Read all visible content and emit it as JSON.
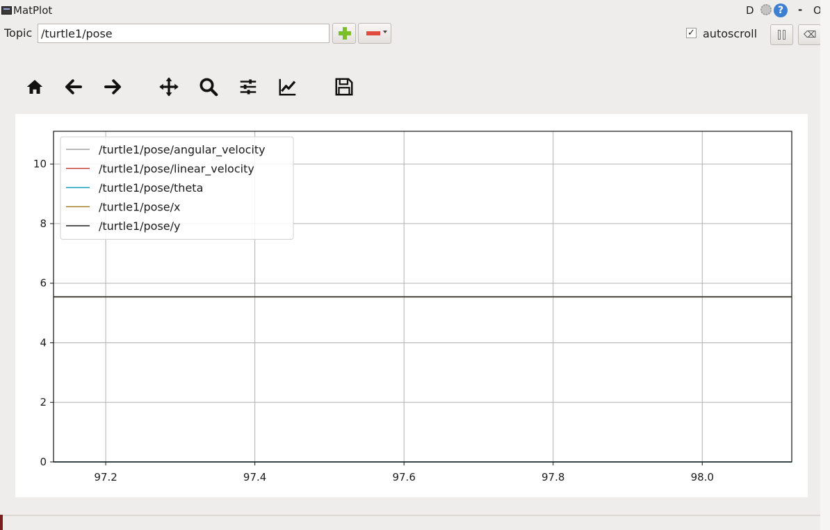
{
  "window": {
    "title": "MatPlot",
    "d_label": "D",
    "help_label": "?",
    "minimize_label": "-",
    "close_label": "O"
  },
  "topic": {
    "label": "Topic",
    "value": "/turtle1/pose"
  },
  "autoscroll": {
    "label": "autoscroll",
    "checked": true
  },
  "icons": {
    "home": "home-icon",
    "back": "back-arrow-icon",
    "forward": "forward-arrow-icon",
    "pan": "pan-icon",
    "zoom": "zoom-icon",
    "configure": "configure-subplots-icon",
    "edit": "edit-axis-icon",
    "save": "save-icon",
    "add": "plus-icon",
    "remove": "minus-icon",
    "pause": "pause-icon",
    "clear": "clear-icon"
  },
  "chart_data": {
    "type": "line",
    "xlim": [
      97.13,
      98.12
    ],
    "ylim": [
      0,
      11.1
    ],
    "xticks": [
      97.2,
      97.4,
      97.6,
      97.8,
      98.0
    ],
    "xtick_labels": [
      "97.2",
      "97.4",
      "97.6",
      "97.8",
      "98.0"
    ],
    "yticks": [
      0,
      2,
      4,
      6,
      8,
      10
    ],
    "ytick_labels": [
      "0",
      "2",
      "4",
      "6",
      "8",
      "10"
    ],
    "grid": true,
    "legend_position": "top-left",
    "series": [
      {
        "name": "/turtle1/pose/angular_velocity",
        "color": "#a0a0a0",
        "x": [
          97.13,
          98.12
        ],
        "y": [
          0,
          0
        ]
      },
      {
        "name": "/turtle1/pose/linear_velocity",
        "color": "#c0392b",
        "x": [
          97.13,
          98.12
        ],
        "y": [
          0,
          0
        ]
      },
      {
        "name": "/turtle1/pose/theta",
        "color": "#17a2b8",
        "x": [
          97.13,
          98.12
        ],
        "y": [
          0,
          0
        ]
      },
      {
        "name": "/turtle1/pose/x",
        "color": "#a07a20",
        "x": [
          97.13,
          98.12
        ],
        "y": [
          5.54,
          5.54
        ]
      },
      {
        "name": "/turtle1/pose/y",
        "color": "#1a1a1a",
        "x": [
          97.13,
          98.12
        ],
        "y": [
          5.54,
          5.54
        ]
      }
    ]
  }
}
